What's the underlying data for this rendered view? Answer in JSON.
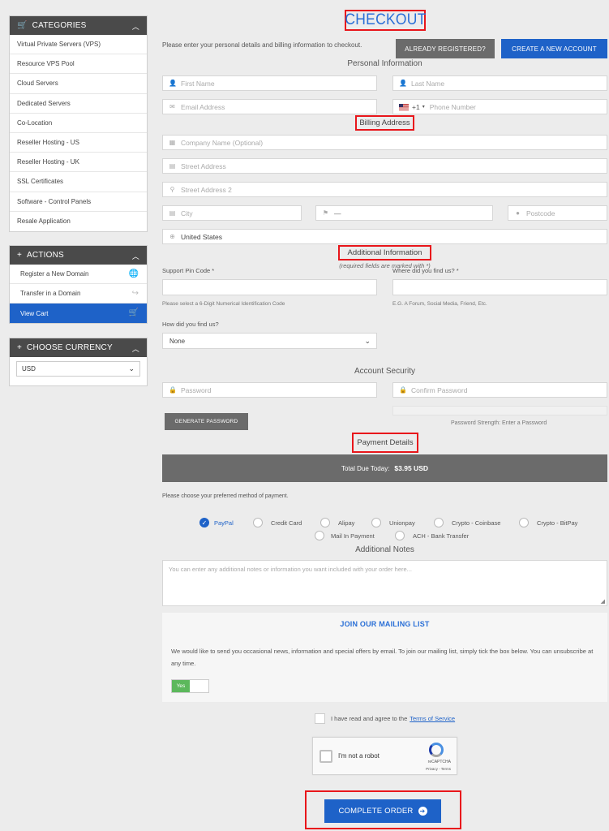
{
  "sidebar": {
    "categories": {
      "title": "CATEGORIES",
      "items": [
        "Virtual Private Servers (VPS)",
        "Resource VPS Pool",
        "Cloud Servers",
        "Dedicated Servers",
        "Co-Location",
        "Reseller Hosting - US",
        "Reseller Hosting - UK",
        "SSL Certificates",
        "Software - Control Panels",
        "Resale Application"
      ]
    },
    "actions": {
      "title": "ACTIONS",
      "items": [
        "Register a New Domain",
        "Transfer in a Domain",
        "View Cart"
      ]
    },
    "currency": {
      "title": "CHOOSE CURRENCY",
      "selected": "USD"
    }
  },
  "header": {
    "title": "CHECKOUT",
    "intro": "Please enter your personal details and billing information to checkout.",
    "already_registered": "ALREADY REGISTERED?",
    "create_account": "CREATE A NEW ACCOUNT"
  },
  "personal": {
    "heading": "Personal Information",
    "first_name": "First Name",
    "last_name": "Last Name",
    "email": "Email Address",
    "phone_code": "+1",
    "phone": "Phone Number"
  },
  "billing": {
    "heading": "Billing Address",
    "company": "Company Name (Optional)",
    "street": "Street Address",
    "street2": "Street Address 2",
    "city": "City",
    "state": "—",
    "postcode": "Postcode",
    "country": "United States"
  },
  "additional": {
    "heading": "Additional Information",
    "required_note": "(required fields are marked with *)",
    "pin_label": "Support Pin Code *",
    "pin_hint": "Please select a 6-Digit Numerical Identification Code",
    "where_label": "Where did you find us? *",
    "where_hint": "E.G. A Forum, Social Media, Friend, Etc.",
    "how_label": "How did you find us?",
    "how_selected": "None"
  },
  "security": {
    "heading": "Account Security",
    "password": "Password",
    "confirm": "Confirm Password",
    "generate": "GENERATE PASSWORD",
    "strength": "Password Strength: Enter a Password"
  },
  "payment": {
    "heading": "Payment Details",
    "total_label": "Total Due Today:",
    "total_value": "$3.95 USD",
    "choose": "Please choose your preferred method of payment.",
    "methods": [
      "PayPal",
      "Credit Card",
      "Alipay",
      "Unionpay",
      "Crypto - Coinbase",
      "Crypto - BitPay",
      "Mail In Payment",
      "ACH - Bank Transfer"
    ],
    "selected": "PayPal"
  },
  "notes": {
    "heading": "Additional Notes",
    "placeholder": "You can enter any additional notes or information you want included with your order here..."
  },
  "mailing": {
    "title": "JOIN OUR MAILING LIST",
    "text": "We would like to send you occasional news, information and special offers by email. To join our mailing list, simply tick the box below. You can unsubscribe at any time.",
    "toggle_label": "Yes"
  },
  "terms": {
    "prefix": "I have read and agree to the",
    "link": "Terms of Service"
  },
  "recaptcha": {
    "label": "I'm not a robot",
    "brand": "reCAPTCHA",
    "links": "Privacy - Terms"
  },
  "order": {
    "label": "COMPLETE ORDER"
  }
}
